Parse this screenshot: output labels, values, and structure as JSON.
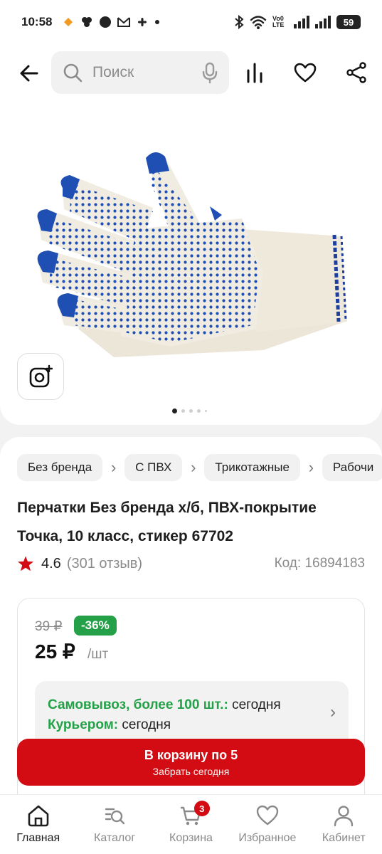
{
  "status_bar": {
    "time": "10:58",
    "battery": "59",
    "network": "Vo0 LTE"
  },
  "top_bar": {
    "search_placeholder": "Поиск"
  },
  "gallery": {
    "image_count": 5,
    "active_index": 0
  },
  "breadcrumbs": [
    "Без бренда",
    "С ПВХ",
    "Трикотажные",
    "Рабочи"
  ],
  "product": {
    "title": "Перчатки Без бренда х/б, ПВХ-покрытие Точка, 10 класс, стикер 67702",
    "rating": "4.6",
    "reviews": "(301 отзыв)",
    "code": "Код: 16894183"
  },
  "price": {
    "old": "39 ₽",
    "discount": "-36%",
    "current": "25 ₽",
    "unit": "/шт"
  },
  "delivery": {
    "pickup_label": "Самовывоз, более 100 шт.:",
    "pickup_value": "сегодня",
    "courier_label": "Курьером:",
    "courier_value": "сегодня"
  },
  "cart_button": {
    "line1": "В корзину по 5",
    "line2": "Забрать сегодня"
  },
  "bottom_nav": [
    {
      "label": "Главная",
      "icon": "home-icon",
      "active": true
    },
    {
      "label": "Каталог",
      "icon": "catalog-search-icon",
      "active": false
    },
    {
      "label": "Корзина",
      "icon": "cart-icon",
      "active": false,
      "badge": "3"
    },
    {
      "label": "Избранное",
      "icon": "heart-icon",
      "active": false
    },
    {
      "label": "Кабинет",
      "icon": "user-icon",
      "active": false
    }
  ],
  "colors": {
    "accent_red": "#d20c12",
    "discount_green": "#24a148",
    "glove_dots": "#1f4fb3"
  }
}
